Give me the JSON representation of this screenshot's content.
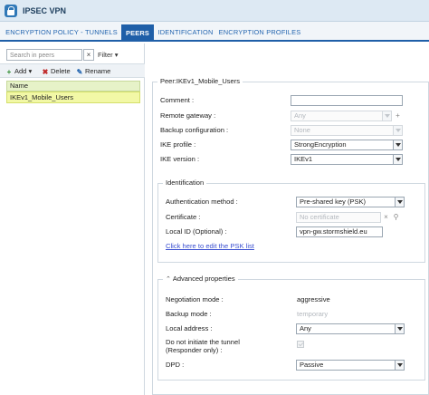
{
  "window": {
    "title": "IPSEC VPN"
  },
  "tabs": [
    {
      "label": "ENCRYPTION POLICY - TUNNELS"
    },
    {
      "label": "PEERS"
    },
    {
      "label": "IDENTIFICATION"
    },
    {
      "label": "ENCRYPTION PROFILES"
    }
  ],
  "left": {
    "search_placeholder": "Search in peers",
    "filter_label": "Filter",
    "toolbar": {
      "add": "Add",
      "delete": "Delete",
      "rename": "Rename"
    },
    "grid": {
      "header": "Name",
      "rows": [
        "IKEv1_Mobile_Users"
      ]
    }
  },
  "peer": {
    "legend": "Peer:IKEv1_Mobile_Users",
    "comment": {
      "label": "Comment :",
      "value": ""
    },
    "remote_gateway": {
      "label": "Remote gateway :",
      "value": "Any"
    },
    "backup_configuration": {
      "label": "Backup configuration :",
      "value": "None"
    },
    "ike_profile": {
      "label": "IKE profile :",
      "value": "StrongEncryption"
    },
    "ike_version": {
      "label": "IKE version :",
      "value": "IKEv1"
    }
  },
  "identification": {
    "legend": "Identification",
    "auth_method": {
      "label": "Authentication method :",
      "value": "Pre-shared key (PSK)"
    },
    "certificate": {
      "label": "Certificate :",
      "value": "No certificate"
    },
    "local_id": {
      "label": "Local ID (Optional) :",
      "value": "vpn-gw.stormshield.eu"
    },
    "psk_link": "Click here to edit the PSK list"
  },
  "advanced": {
    "legend": "Advanced properties",
    "negotiation_mode": {
      "label": "Negotiation mode :",
      "value": "aggressive"
    },
    "backup_mode": {
      "label": "Backup mode :",
      "value": "temporary"
    },
    "local_address": {
      "label": "Local address :",
      "value": "Any"
    },
    "do_not_initiate": {
      "label_line1": "Do not initiate the tunnel",
      "label_line2": "(Responder only) :",
      "checked": true,
      "disabled": true
    },
    "dpd": {
      "label": "DPD :",
      "value": "Passive"
    }
  },
  "colors": {
    "accent": "#1f5fa8",
    "selected_row": "#f2f8a6",
    "link": "#3a4fd0"
  }
}
